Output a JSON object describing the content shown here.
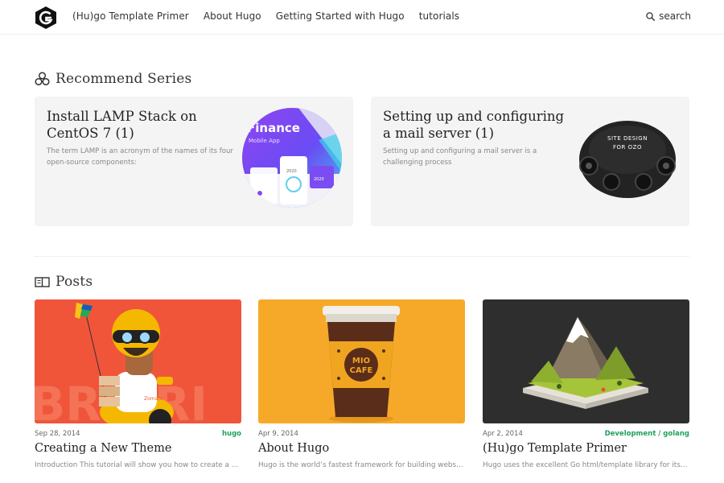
{
  "header": {
    "nav": [
      {
        "label": "(Hu)go Template Primer"
      },
      {
        "label": "About Hugo"
      },
      {
        "label": "Getting Started with Hugo"
      },
      {
        "label": "tutorials"
      }
    ],
    "search_label": "search"
  },
  "series": {
    "title": "Recommend Series",
    "items": [
      {
        "title": "Install LAMP Stack on CentOS 7 (1)",
        "desc": "The term LAMP is an acronym of the names of its four open-source components:",
        "thumb_text": {
          "main": "Finance",
          "sub": "Mobile App",
          "badge1": "2020",
          "badge2": "2020"
        }
      },
      {
        "title": "Setting up and configuring a mail server (1)",
        "desc": "Setting up and configuring a mail server is a challenging process",
        "thumb_text": {
          "line1": "SITE DESIGN",
          "line2": "FOR OZO"
        }
      }
    ]
  },
  "posts": {
    "title": "Posts",
    "items": [
      {
        "date": "Sep 28, 2014",
        "tag": "hugo",
        "title": "Creating a New Theme",
        "excerpt": "Introduction This tutorial will show you how to create a simple theme for Hugo",
        "img_text": "BRIBRI",
        "box_label": "Zomato"
      },
      {
        "date": "Apr 9, 2014",
        "tag": "",
        "title": "About Hugo",
        "excerpt": "Hugo is the world’s fastest framework for building websites. It is written in Go",
        "cup_line1": "MIO",
        "cup_line2": "CAFE"
      },
      {
        "date": "Apr 2, 2014",
        "tag": "Development / golang",
        "title": "(Hu)go Template Primer",
        "excerpt": "Hugo uses the excellent Go html/template library for its template engine"
      }
    ]
  },
  "colors": {
    "accent": "#20a15a",
    "card_bg": "#f4f4f4"
  }
}
